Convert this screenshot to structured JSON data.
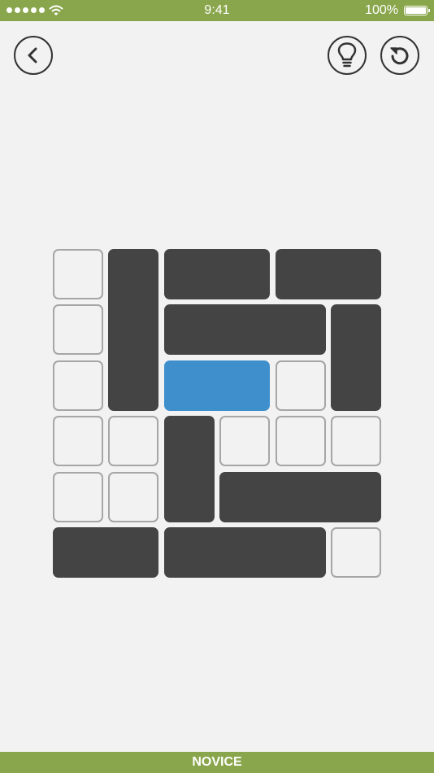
{
  "status_bar": {
    "time": "9:41",
    "battery": "100%",
    "icons": [
      "signal-dots-icon",
      "wifi-icon",
      "battery-icon"
    ]
  },
  "toolbar": {
    "back_icon": "chevron-left-icon",
    "hint_icon": "lightbulb-icon",
    "reset_icon": "undo-arrow-icon"
  },
  "board": {
    "rows": 6,
    "cols": 6,
    "blocks": [
      {
        "row": 0,
        "col": 1,
        "w": 1,
        "h": 3,
        "kind": "block"
      },
      {
        "row": 0,
        "col": 2,
        "w": 2,
        "h": 1,
        "kind": "block"
      },
      {
        "row": 0,
        "col": 4,
        "w": 2,
        "h": 1,
        "kind": "block"
      },
      {
        "row": 1,
        "col": 2,
        "w": 3,
        "h": 1,
        "kind": "block"
      },
      {
        "row": 1,
        "col": 5,
        "w": 1,
        "h": 2,
        "kind": "block"
      },
      {
        "row": 2,
        "col": 2,
        "w": 2,
        "h": 1,
        "kind": "target"
      },
      {
        "row": 3,
        "col": 2,
        "w": 1,
        "h": 2,
        "kind": "block"
      },
      {
        "row": 4,
        "col": 3,
        "w": 3,
        "h": 1,
        "kind": "block"
      },
      {
        "row": 5,
        "col": 0,
        "w": 2,
        "h": 1,
        "kind": "block"
      },
      {
        "row": 5,
        "col": 2,
        "w": 3,
        "h": 1,
        "kind": "block"
      }
    ],
    "empty_cells": [
      [
        0,
        0
      ],
      [
        1,
        0
      ],
      [
        2,
        0
      ],
      [
        2,
        4
      ],
      [
        3,
        0
      ],
      [
        3,
        1
      ],
      [
        3,
        3
      ],
      [
        3,
        4
      ],
      [
        3,
        5
      ],
      [
        4,
        0
      ],
      [
        4,
        1
      ],
      [
        5,
        5
      ]
    ],
    "colors": {
      "block": "#444444",
      "target": "#3f8fcc",
      "cell_border": "#a6a6a6",
      "accent": "#8aa64c"
    }
  },
  "level": {
    "label": "NOVICE"
  }
}
